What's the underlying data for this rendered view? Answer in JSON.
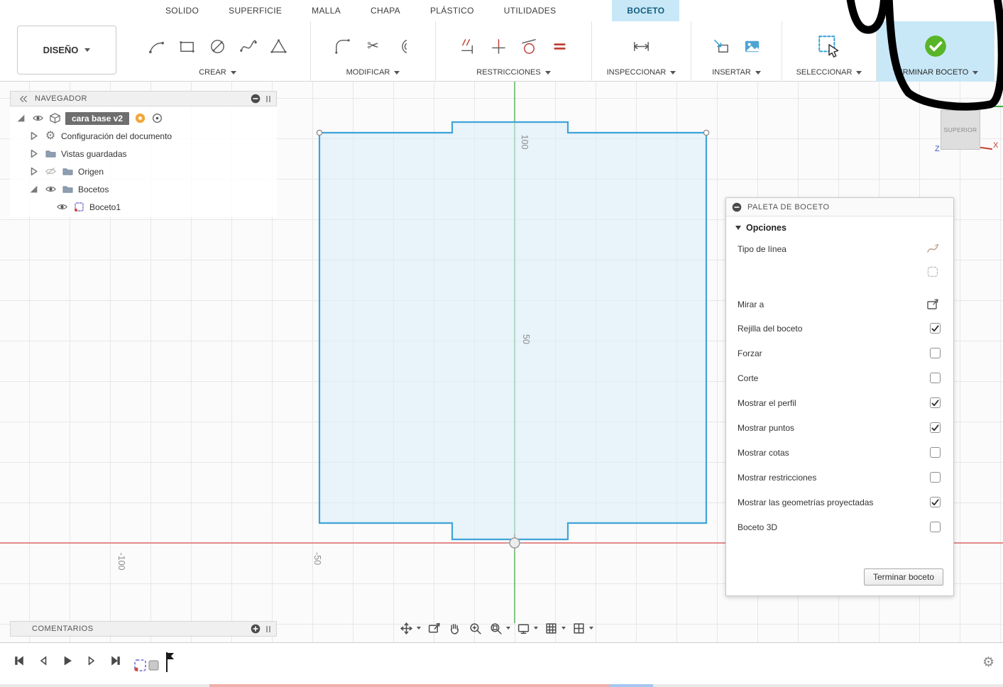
{
  "colors": {
    "tab_active_bg": "#c8e8f7",
    "tab_active_text": "#135d7f",
    "accent_blue": "#2f9fd6",
    "check_green": "#58b527",
    "selected_bg": "#6e6e6e",
    "axis_red": "#e06666",
    "axis_green": "#55b355",
    "shape_stroke": "#3fa4d8",
    "shape_fill": "#d8ecf9"
  },
  "tabs": {
    "items": [
      "SOLIDO",
      "SUPERFICIE",
      "MALLA",
      "CHAPA",
      "PLÁSTICO",
      "UTILIDADES",
      "BOCETO"
    ],
    "active": "BOCETO"
  },
  "toolbar": {
    "design_button": "DISEÑO",
    "groups": [
      {
        "label": "CREAR"
      },
      {
        "label": "MODIFICAR"
      },
      {
        "label": "RESTRICCIONES"
      },
      {
        "label": "INSPECCIONAR"
      },
      {
        "label": "INSERTAR"
      },
      {
        "label": "SELECCIONAR"
      },
      {
        "label": "TERMINAR BOCETO"
      }
    ]
  },
  "navigator": {
    "title": "NAVEGADOR",
    "items": [
      {
        "label": "cara base v2"
      },
      {
        "label": "Configuración del documento"
      },
      {
        "label": "Vistas guardadas"
      },
      {
        "label": "Origen"
      },
      {
        "label": "Bocetos"
      },
      {
        "label": "Boceto1"
      }
    ]
  },
  "canvas": {
    "ruler_labels": [
      "100",
      "50",
      "-50",
      "-100"
    ]
  },
  "viewcube": {
    "face": "SUPERIOR",
    "axis_z": "Z",
    "axis_x": "X"
  },
  "palette": {
    "title": "PALETA DE BOCETO",
    "section": "Opciones",
    "rows": [
      {
        "label": "Tipo de línea",
        "type": "icon"
      },
      {
        "label": "",
        "type": "icon"
      },
      {
        "label": "Mirar a",
        "type": "icon"
      },
      {
        "label": "Rejilla del boceto",
        "type": "checkbox",
        "checked": true
      },
      {
        "label": "Forzar",
        "type": "checkbox",
        "checked": false
      },
      {
        "label": "Corte",
        "type": "checkbox",
        "checked": false
      },
      {
        "label": "Mostrar el perfil",
        "type": "checkbox",
        "checked": true
      },
      {
        "label": "Mostrar puntos",
        "type": "checkbox",
        "checked": true
      },
      {
        "label": "Mostrar cotas",
        "type": "checkbox",
        "checked": false
      },
      {
        "label": "Mostrar restricciones",
        "type": "checkbox",
        "checked": false
      },
      {
        "label": "Mostrar las geometrías proyectadas",
        "type": "checkbox",
        "checked": true
      },
      {
        "label": "Boceto 3D",
        "type": "checkbox",
        "checked": false
      }
    ],
    "finish_button": "Terminar boceto"
  },
  "comments": {
    "title": "COMENTARIOS"
  },
  "icons": {
    "scissors": "✂",
    "gear": "⚙"
  }
}
